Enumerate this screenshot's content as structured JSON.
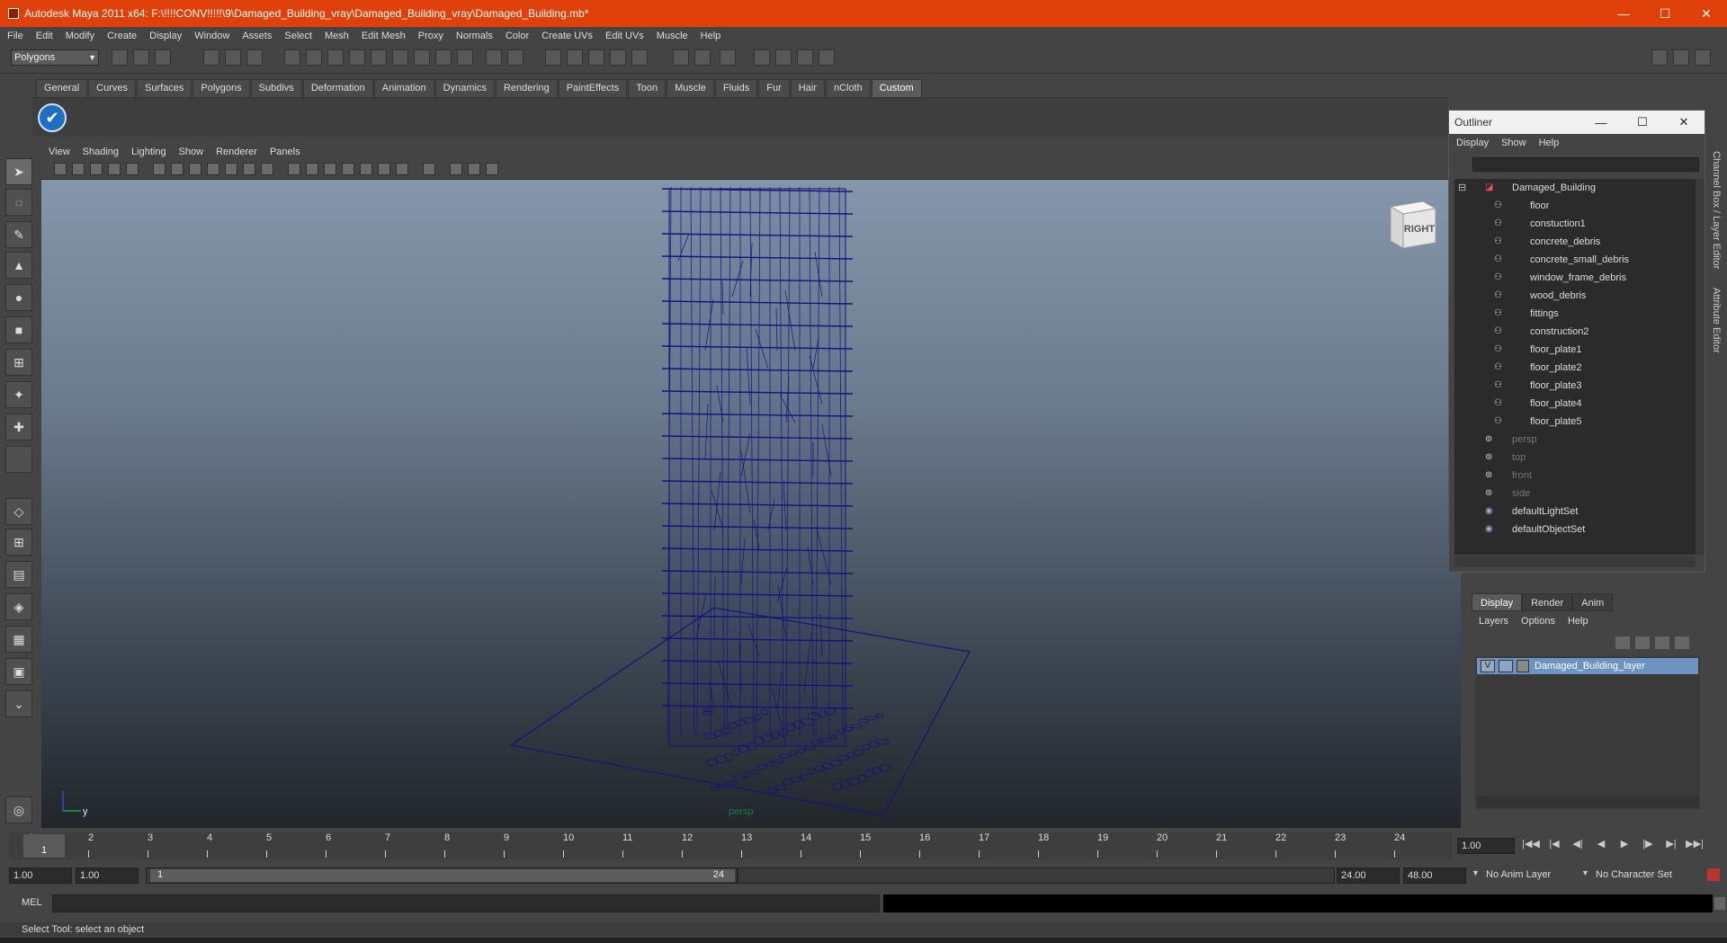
{
  "window": {
    "title": "Autodesk Maya 2011 x64: F:\\!!!!CONV!!!!!\\9\\Damaged_Building_vray\\Damaged_Building_vray\\Damaged_Building.mb*",
    "minimize": "—",
    "maximize": "☐",
    "close": "✕"
  },
  "menubar": [
    "File",
    "Edit",
    "Modify",
    "Create",
    "Display",
    "Window",
    "Assets",
    "Select",
    "Mesh",
    "Edit Mesh",
    "Proxy",
    "Normals",
    "Color",
    "Create UVs",
    "Edit UVs",
    "Muscle",
    "Help"
  ],
  "status_line": {
    "mode": "Polygons"
  },
  "shelf_tabs": [
    "General",
    "Curves",
    "Surfaces",
    "Polygons",
    "Subdivs",
    "Deformation",
    "Animation",
    "Dynamics",
    "Rendering",
    "PaintEffects",
    "Toon",
    "Muscle",
    "Fluids",
    "Fur",
    "Hair",
    "nCloth",
    "Custom"
  ],
  "active_shelf": "Custom",
  "panel_menu": [
    "View",
    "Shading",
    "Lighting",
    "Show",
    "Renderer",
    "Panels"
  ],
  "viewport": {
    "camera": "persp",
    "viewcube_face": "RIGHT",
    "axis_y": "y"
  },
  "outliner": {
    "title": "Outliner",
    "menu": [
      "Display",
      "Show",
      "Help"
    ],
    "root": "Damaged_Building",
    "children": [
      "floor",
      "constuction1",
      "concrete_debris",
      "concrete_small_debris",
      "window_frame_debris",
      "wood_debris",
      "fittings",
      "construction2",
      "floor_plate1",
      "floor_plate2",
      "floor_plate3",
      "floor_plate4",
      "floor_plate5"
    ],
    "cameras": [
      "persp",
      "top",
      "front",
      "side"
    ],
    "sets": [
      "defaultLightSet",
      "defaultObjectSet"
    ]
  },
  "side_tabs": [
    "Channel Box / Layer Editor",
    "Attribute Editor"
  ],
  "layer_editor": {
    "tabs": [
      "Display",
      "Render",
      "Anim"
    ],
    "active_tab": "Display",
    "menu": [
      "Layers",
      "Options",
      "Help"
    ],
    "layer": {
      "visible": "V",
      "name": "Damaged_Building_layer"
    }
  },
  "timeline": {
    "ticks": [
      "1",
      "2",
      "3",
      "4",
      "5",
      "6",
      "7",
      "8",
      "9",
      "10",
      "11",
      "12",
      "13",
      "14",
      "15",
      "16",
      "17",
      "18",
      "19",
      "20",
      "21",
      "22",
      "23",
      "24"
    ],
    "current_frame_label": "1",
    "current_time": "1.00"
  },
  "range": {
    "start": "1.00",
    "playback_start": "1.00",
    "slider_start": "1",
    "slider_end": "24",
    "playback_end": "24.00",
    "end": "48.00",
    "anim_layer": "No Anim Layer",
    "character_set": "No Character Set"
  },
  "command_line": {
    "label": "MEL"
  },
  "help_line": "Select Tool: select an object",
  "colors": {
    "titlebar": "#e0400a",
    "wireframe": "#14147a",
    "layer_highlight": "#6d93c3"
  }
}
